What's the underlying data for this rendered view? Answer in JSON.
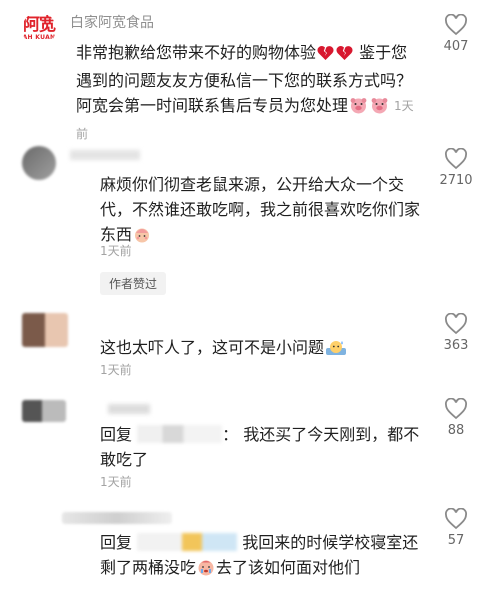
{
  "comments": [
    {
      "username": "白家阿宽食品",
      "logo_cn": "阿宽",
      "logo_en": "AH KUAN",
      "text": "非常抱歉给您带来不好的购物体验💔💔 鉴于您遇到的问题友友方便私信一下您的联系方式吗？阿宽会第一时间联系售后专员为您处理",
      "time": "1天前",
      "likes": "407"
    },
    {
      "username": "",
      "text": "麻烦你们彻查老鼠来源，公开给大众一个交代，不然谁还敢吃啊，我之前很喜欢吃你们家东西",
      "time": "1天前",
      "likes": "2710",
      "author_liked": "作者赞过"
    },
    {
      "username": "",
      "text": "这也太吓人了，这可不是小问题",
      "time": "1天前",
      "likes": "363"
    },
    {
      "username": "",
      "reply_prefix": "回复",
      "text": "：  我还买了今天刚到，都不敢吃了",
      "time": "1天前",
      "likes": "88"
    },
    {
      "username": "",
      "reply_prefix": "回复",
      "text": " 我回来的时候学校寝室还剩了两桶没吃",
      "text2": "去了该如何面对他们",
      "likes": "57"
    }
  ],
  "colors": {
    "accent": "#e0242c",
    "secondary_text": "#8f8f8f"
  }
}
